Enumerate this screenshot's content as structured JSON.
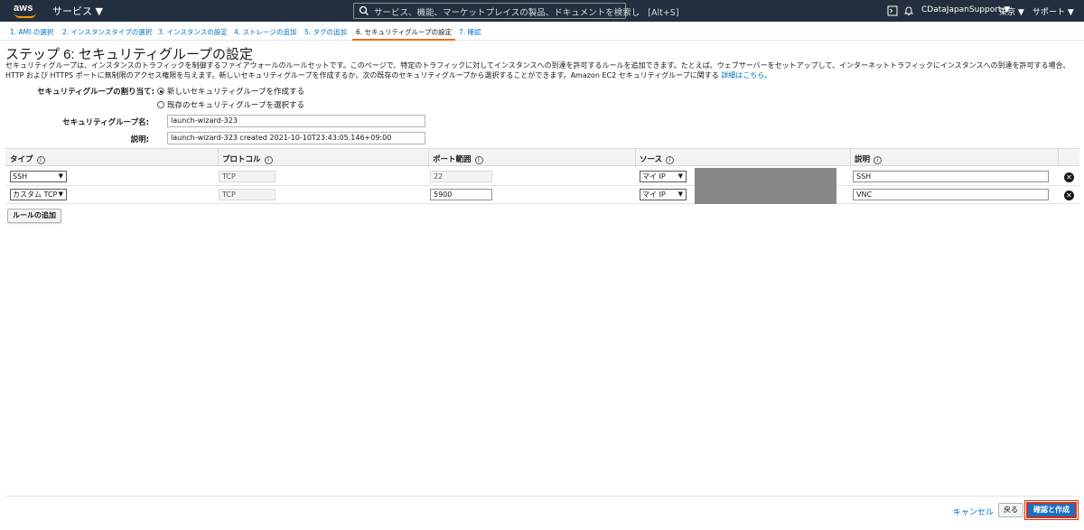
{
  "topbar": {
    "logo_text": "aws",
    "services_label": "サービス ▼",
    "search_placeholder": "サービス、機能、マーケットプレイスの製品、ドキュメントを検索し",
    "search_shortcut": "[Alt+S]",
    "account": "CDataJapanSupport ▼",
    "region": "東京 ▼",
    "support": "サポート ▼",
    "accent_color": "#ff9900",
    "bg_color": "#232f3e"
  },
  "steps": [
    {
      "label": "1. AMI の選択"
    },
    {
      "label": "2. インスタンスタイプの選択"
    },
    {
      "label": "3. インスタンスの設定"
    },
    {
      "label": "4. ストレージの追加"
    },
    {
      "label": "5. タグの追加"
    },
    {
      "label": "6. セキュリティグループの設定"
    },
    {
      "label": "7. 確認"
    }
  ],
  "page": {
    "title": "ステップ 6: セキュリティグループの設定",
    "intro": "セキュリティグループは、インスタンスのトラフィックを制御するファイアウォールのルールセットです。このページで、特定のトラフィックに対してインスタンスへの到達を許可するルールを追加できます。たとえば、ウェブサーバーをセットアップして、インターネットトラフィックにインスタンスへの到達を許可する場合、HTTP および HTTPS ポートに無制限のアクセス権限を与えます。新しいセキュリティグループを作成するか、次の既存のセキュリティグループから選択することができます。Amazon EC2 セキュリティグループに関する",
    "intro_link": "詳細はこちら。"
  },
  "form": {
    "assign_label": "セキュリティグループの割り当て:",
    "radio_new": "新しいセキュリティグループを作成する",
    "radio_existing": "既存のセキュリティグループを選択する",
    "name_label": "セキュリティグループ名:",
    "name_value": "launch-wizard-323",
    "desc_label": "説明:",
    "desc_value": "launch-wizard-323 created 2021-10-10T23:43:05.146+09:00"
  },
  "table": {
    "headers": {
      "type": "タイプ",
      "protocol": "プロトコル",
      "port": "ポート範囲",
      "source": "ソース",
      "description": "説明",
      "info": "i"
    },
    "rows": [
      {
        "type": "SSH",
        "protocol": "TCP",
        "port": "22",
        "source": "マイ IP",
        "description": "SSH"
      },
      {
        "type": "カスタム TCP",
        "protocol": "TCP",
        "port": "5900",
        "source": "マイ IP",
        "description": "VNC"
      }
    ],
    "add_rule_label": "ルールの追加"
  },
  "footer": {
    "cancel_label": "キャンセル",
    "back_label": "戻る",
    "review_label": "確認と作成"
  }
}
